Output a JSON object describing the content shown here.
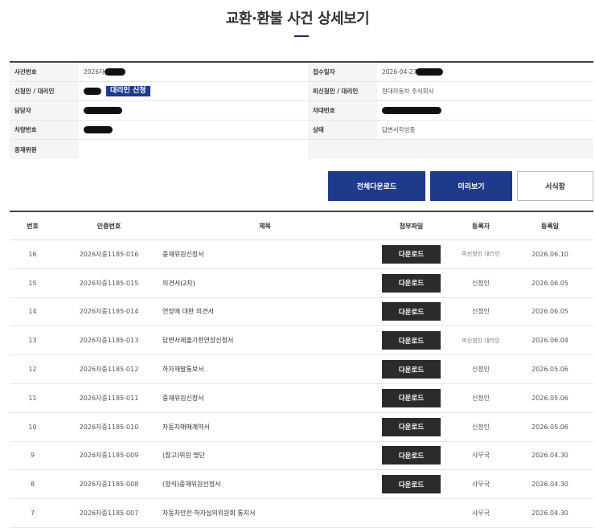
{
  "page": {
    "title": "교환·환불 사건 상세보기"
  },
  "info": {
    "case_no_label": "사건번호",
    "case_no_value": "2026자",
    "receipt_date_label": "접수일자",
    "receipt_date_value": "2026-04-27",
    "applicant_label": "신청인 / 대리인",
    "agent_badge": "대리인 신청",
    "respondent_label": "피신청인 / 대리인",
    "respondent_value": "현대자동차 주식회사",
    "manager_label": "담당자",
    "vehicle_id_label": "차대번호",
    "plate_label": "차량번호",
    "status_label": "상태",
    "status_value": "답변서작성중",
    "arbitrator_label": "중재위원"
  },
  "actions": {
    "download_all": "전체다운로드",
    "preview": "미리보기",
    "form": "서식함"
  },
  "table": {
    "headers": [
      "번호",
      "인증번호",
      "제목",
      "첨부파일",
      "등록자",
      "등록일"
    ],
    "download_label": "다운로드",
    "rows": [
      {
        "no": "16",
        "cert": "2026자중1185-016",
        "title": "중재위원신청서",
        "download": true,
        "registrant": "피신청인 대리인",
        "date": "2026.06.10"
      },
      {
        "no": "15",
        "cert": "2026자중1185-015",
        "title": "의견서(2차)",
        "download": true,
        "registrant": "신청인",
        "date": "2026.06.05"
      },
      {
        "no": "14",
        "cert": "2026자중1185-014",
        "title": "연장에 대한 의견서",
        "download": true,
        "registrant": "신청인",
        "date": "2026.06.05"
      },
      {
        "no": "13",
        "cert": "2026자중1185-013",
        "title": "답변서제출기한연장신청서",
        "download": true,
        "registrant": "피신청인 대리인",
        "date": "2026.06.04"
      },
      {
        "no": "12",
        "cert": "2026자중1185-012",
        "title": "하자재발통보서",
        "download": true,
        "registrant": "신청인",
        "date": "2026.05.06"
      },
      {
        "no": "11",
        "cert": "2026자중1185-011",
        "title": "중재위원신청서",
        "download": true,
        "registrant": "신청인",
        "date": "2026.05.06"
      },
      {
        "no": "10",
        "cert": "2026자중1185-010",
        "title": "자동차매매계약서",
        "download": true,
        "registrant": "신청인",
        "date": "2026.05.06"
      },
      {
        "no": "9",
        "cert": "2026자중1185-009",
        "title": "(참고)위원 명단",
        "download": true,
        "registrant": "사무국",
        "date": "2026.04.30"
      },
      {
        "no": "8",
        "cert": "2026자중1185-008",
        "title": "(양식)중재위원선정서",
        "download": true,
        "registrant": "사무국",
        "date": "2026.04.30"
      },
      {
        "no": "7",
        "cert": "2026자중1185-007",
        "title": "자동차안전·하자심의위원회 통지서",
        "download": false,
        "registrant": "사무국",
        "date": "2026.04.30"
      }
    ]
  }
}
